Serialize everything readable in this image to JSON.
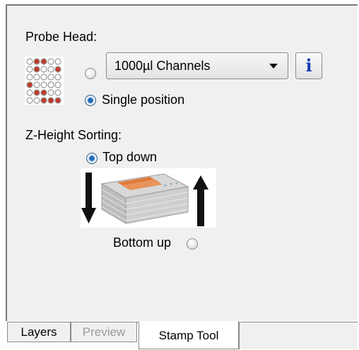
{
  "probe_head": {
    "label": "Probe Head:",
    "channels_select_value": "1000µl Channels",
    "channels_radio_checked": false,
    "single_position_label": "Single position",
    "single_position_checked": true,
    "info_button_label": "i",
    "info_icon": "info-icon",
    "grid_icon": "well-grid-icon"
  },
  "z_height": {
    "label": "Z-Height Sorting:",
    "top_down_label": "Top down",
    "top_down_checked": true,
    "bottom_up_label": "Bottom up",
    "bottom_up_checked": false,
    "illustration": "stacked-plates-icon"
  },
  "tabs": [
    {
      "label": "Layers",
      "state": "normal"
    },
    {
      "label": "Preview",
      "state": "disabled"
    },
    {
      "label": "Stamp Tool",
      "state": "active"
    }
  ],
  "colors": {
    "panel_bg": "#f0f0f0",
    "info_blue": "#1a3fae",
    "radio_selected": "#1d5aa0",
    "well_red": "#c0392b"
  }
}
